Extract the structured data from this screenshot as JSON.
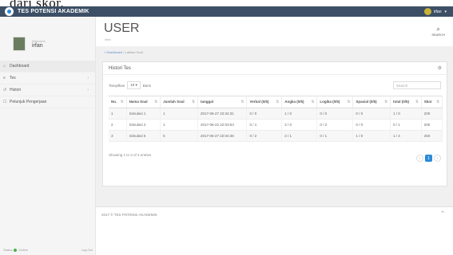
{
  "caption": "dari skor.",
  "topbar": {
    "title": "TES POTENSI AKADEMIK",
    "user": "irfan"
  },
  "sidebar": {
    "welcome": "Welcome,",
    "username": "irfan",
    "items": [
      {
        "label": "Dashboard",
        "icon": "home-icon"
      },
      {
        "label": "Tes",
        "icon": "list-icon"
      },
      {
        "label": "Histori",
        "icon": "history-icon"
      },
      {
        "label": "Petunjuk Pengerjaan",
        "icon": "info-icon"
      }
    ],
    "footer_status": "Online",
    "footer_status_prefix": "Status",
    "footer_logout": "Log Out"
  },
  "header": {
    "title": "USER",
    "subtitle": "irfan",
    "search_label": "SEARCH"
  },
  "breadcrumb": {
    "home": "Dashboard",
    "current": "Latihan Soal"
  },
  "panel": {
    "title": "Histori Tes",
    "show_label": "Tampilkan",
    "entries_value": "10",
    "entries_suffix": "Baris",
    "search_placeholder": "Search",
    "columns": [
      "No.",
      "Nama Soal",
      "Jumlah Soal",
      "tanggal",
      "Verbal (0/5)",
      "Angka (0/5)",
      "Logika (0/5)",
      "Spasial (0/5)",
      "total (0/5)",
      "Skor"
    ],
    "rows": [
      [
        "1",
        "Simulasi 1",
        "1",
        "2017-06-27 22:34:31",
        "0 / 0",
        "1 / 0",
        "0 / 0",
        "0 / 0",
        "1 / 0",
        "200"
      ],
      [
        "2",
        "Simulasi 2",
        "1",
        "2017-06-22 22:03:54",
        "0 / 1",
        "2 / 0",
        "0 / 2",
        "0 / 0",
        "0 / 1",
        "200"
      ],
      [
        "3",
        "Simulasi 5",
        "5",
        "2017-06-27 22:04:36",
        "0 / 2",
        "2 / 1",
        "0 / 1",
        "1 / 0",
        "1 / 4",
        "250"
      ]
    ],
    "showing_text": "Showing 1 to 3 of 3 entries",
    "page_current": "1"
  },
  "footer": {
    "copyright": "2017 © TES POTENSI AKADEMIK"
  }
}
